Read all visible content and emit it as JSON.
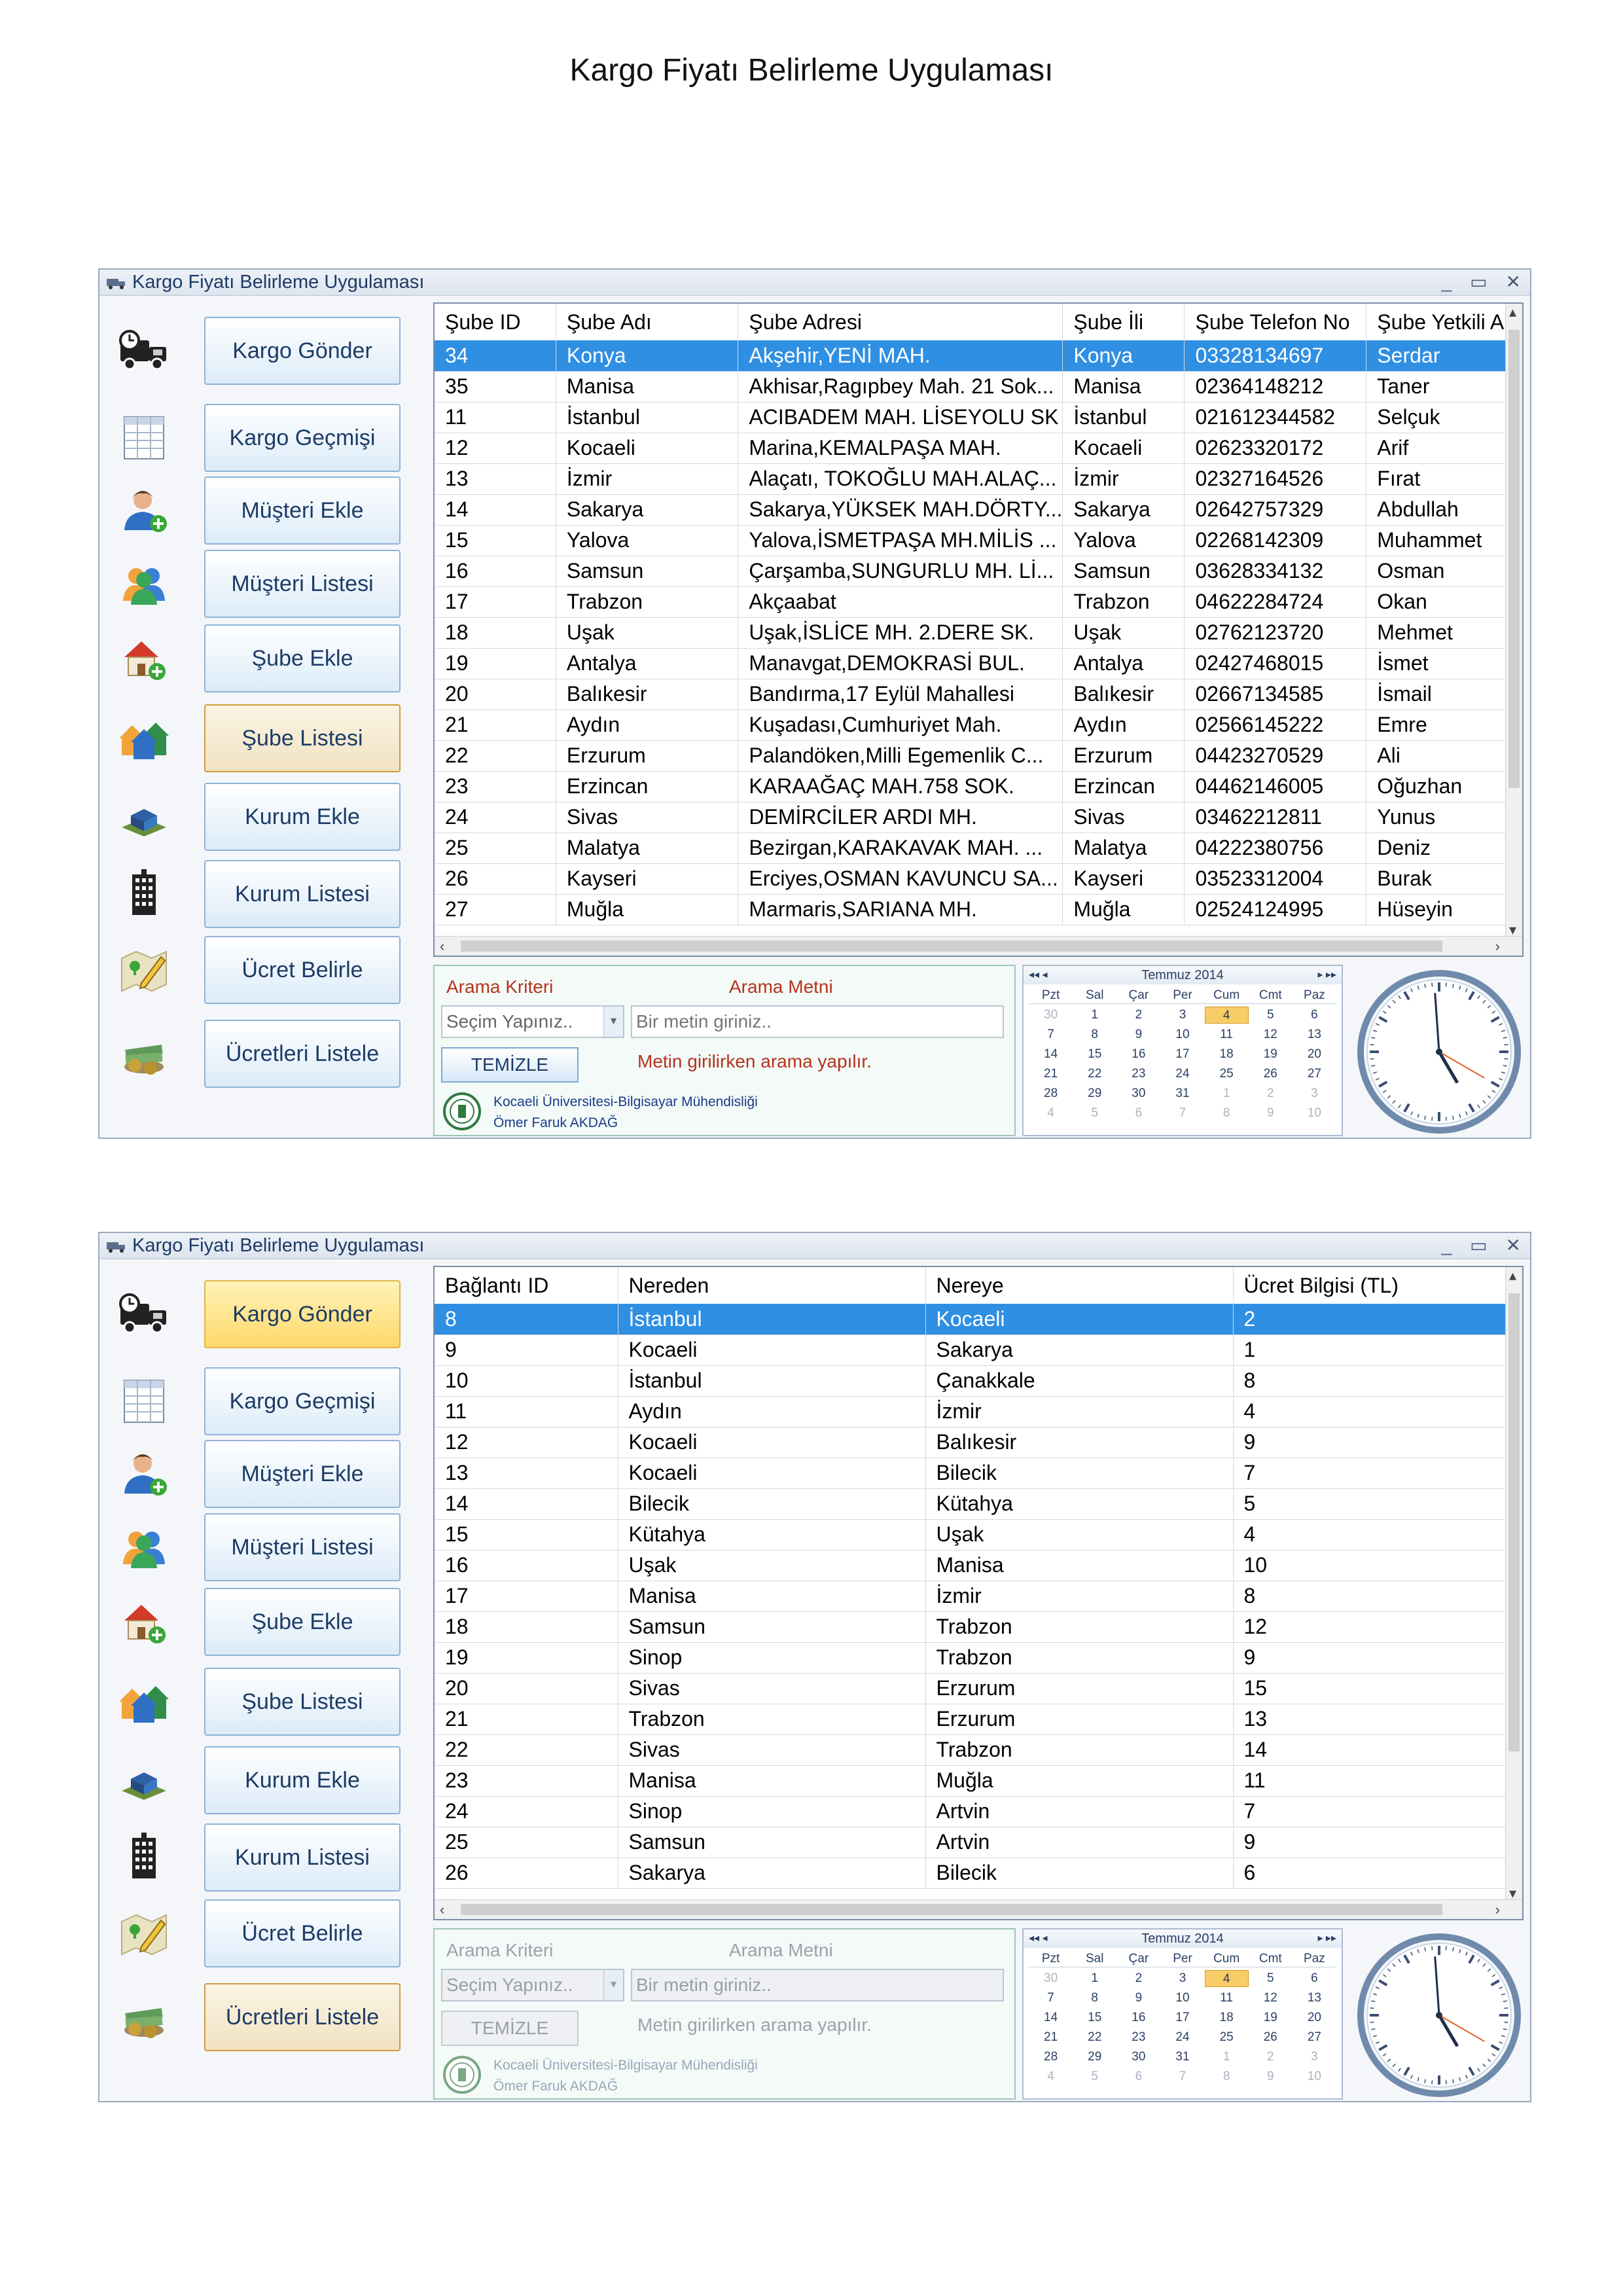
{
  "page_title": "Kargo Fiyatı Belirleme Uygulaması",
  "window_title": "Kargo Fiyatı Belirleme Uygulaması",
  "window_controls": [
    "_",
    "▭",
    "✕"
  ],
  "nav": [
    {
      "label": "Kargo Gönder",
      "icon": "truck-icon"
    },
    {
      "label": "Kargo Geçmişi",
      "icon": "table-icon"
    },
    {
      "label": "Müşteri Ekle",
      "icon": "add-user-icon"
    },
    {
      "label": "Müşteri Listesi",
      "icon": "users-icon"
    },
    {
      "label": "Şube Ekle",
      "icon": "add-house-icon"
    },
    {
      "label": "Şube Listesi",
      "icon": "houses-icon"
    },
    {
      "label": "Kurum Ekle",
      "icon": "building-add-icon"
    },
    {
      "label": "Kurum Listesi",
      "icon": "skyscraper-icon"
    },
    {
      "label": "Ücret Belirle",
      "icon": "map-pen-icon"
    },
    {
      "label": "Ücretleri Listele",
      "icon": "money-icon"
    }
  ],
  "window1": {
    "active_nav": "Şube Listesi",
    "columns": [
      "Şube ID",
      "Şube Adı",
      "Şube Adresi",
      "Şube İli",
      "Şube Telefon No",
      "Şube Yetkili A"
    ],
    "rows": [
      [
        "34",
        "Konya",
        "Akşehir,YENİ MAH.",
        "Konya",
        "03328134697",
        "Serdar"
      ],
      [
        "35",
        "Manisa",
        "Akhisar,Ragıpbey Mah. 21 Sok...",
        "Manisa",
        "02364148212",
        "Taner"
      ],
      [
        "11",
        "İstanbul",
        "ACIBADEM MAH. LİSEYOLU SK",
        "İstanbul",
        "021612344582",
        "Selçuk"
      ],
      [
        "12",
        "Kocaeli",
        "Marina,KEMALPAŞA MAH.",
        "Kocaeli",
        "02623320172",
        "Arif"
      ],
      [
        "13",
        "İzmir",
        "Alaçatı, TOKOĞLU MAH.ALAÇ...",
        "İzmir",
        "02327164526",
        "Fırat"
      ],
      [
        "14",
        "Sakarya",
        "Sakarya,YÜKSEK MAH.DÖRTY...",
        "Sakarya",
        "02642757329",
        "Abdullah"
      ],
      [
        "15",
        "Yalova",
        "Yalova,İSMETPAŞA MH.MİLİS ...",
        "Yalova",
        "02268142309",
        "Muhammet"
      ],
      [
        "16",
        "Samsun",
        "Çarşamba,SUNGURLU MH. Lİ...",
        "Samsun",
        "03628334132",
        "Osman"
      ],
      [
        "17",
        "Trabzon",
        "Akçaabat",
        "Trabzon",
        "04622284724",
        "Okan"
      ],
      [
        "18",
        "Uşak",
        "Uşak,İSLİCE MH. 2.DERE SK.",
        "Uşak",
        "02762123720",
        "Mehmet"
      ],
      [
        "19",
        "Antalya",
        "Manavgat,DEMOKRASİ BUL.",
        "Antalya",
        "02427468015",
        "İsmet"
      ],
      [
        "20",
        "Balıkesir",
        "Bandırma,17 Eylül Mahallesi",
        "Balıkesir",
        "02667134585",
        "İsmail"
      ],
      [
        "21",
        "Aydın",
        "Kuşadası,Cumhuriyet Mah.",
        "Aydın",
        "02566145222",
        "Emre"
      ],
      [
        "22",
        "Erzurum",
        "Palandöken,Milli Egemenlik C...",
        "Erzurum",
        "04423270529",
        "Ali"
      ],
      [
        "23",
        "Erzincan",
        "KARAAĞAÇ MAH.758 SOK.",
        "Erzincan",
        "04462146005",
        "Oğuzhan"
      ],
      [
        "24",
        "Sivas",
        "DEMİRCİLER ARDI MH.",
        "Sivas",
        "03462212811",
        "Yunus"
      ],
      [
        "25",
        "Malatya",
        "Bezirgan,KARAKAVAK MAH. ...",
        "Malatya",
        "04222380756",
        "Deniz"
      ],
      [
        "26",
        "Kayseri",
        "Erciyes,OSMAN KAVUNCU SA...",
        "Kayseri",
        "03523312004",
        "Burak"
      ],
      [
        "27",
        "Muğla",
        "Marmaris,SARIANA MH.",
        "Muğla",
        "02524124995",
        "Hüseyin"
      ]
    ]
  },
  "window2": {
    "active_nav": "Ücretleri Listele",
    "columns": [
      "Bağlantı ID",
      "Nereden",
      "Nereye",
      "Ücret Bilgisi (TL)"
    ],
    "rows": [
      [
        "8",
        "İstanbul",
        "Kocaeli",
        "2"
      ],
      [
        "9",
        "Kocaeli",
        "Sakarya",
        "1"
      ],
      [
        "10",
        "İstanbul",
        "Çanakkale",
        "8"
      ],
      [
        "11",
        "Aydın",
        "İzmir",
        "4"
      ],
      [
        "12",
        "Kocaeli",
        "Balıkesir",
        "9"
      ],
      [
        "13",
        "Kocaeli",
        "Bilecik",
        "7"
      ],
      [
        "14",
        "Bilecik",
        "Kütahya",
        "5"
      ],
      [
        "15",
        "Kütahya",
        "Uşak",
        "4"
      ],
      [
        "16",
        "Uşak",
        "Manisa",
        "10"
      ],
      [
        "17",
        "Manisa",
        "İzmir",
        "8"
      ],
      [
        "18",
        "Samsun",
        "Trabzon",
        "12"
      ],
      [
        "19",
        "Sinop",
        "Trabzon",
        "9"
      ],
      [
        "20",
        "Sivas",
        "Erzurum",
        "15"
      ],
      [
        "21",
        "Trabzon",
        "Erzurum",
        "13"
      ],
      [
        "22",
        "Sivas",
        "Trabzon",
        "14"
      ],
      [
        "23",
        "Manisa",
        "Muğla",
        "11"
      ],
      [
        "24",
        "Sinop",
        "Artvin",
        "7"
      ],
      [
        "25",
        "Samsun",
        "Artvin",
        "9"
      ],
      [
        "26",
        "Sakarya",
        "Bilecik",
        "6"
      ]
    ]
  },
  "search": {
    "criteria_label": "Arama Kriteri",
    "text_label": "Arama Metni",
    "select_value": "Seçim Yapınız..",
    "text_placeholder": "Bir metin giriniz..",
    "clear_button": "TEMİZLE",
    "hint": "Metin girilirken arama yapılır.",
    "institution": "Kocaeli Üniversitesi-Bilgisayar Mühendisliği",
    "author": "Ömer Faruk AKDAĞ"
  },
  "calendar": {
    "month_label": "Temmuz 2014",
    "nav_prev": "◂◂ ◂",
    "nav_next": "▸ ▸▸",
    "day_headers": [
      "Pzt",
      "Sal",
      "Çar",
      "Per",
      "Cum",
      "Cmt",
      "Paz"
    ],
    "today": "4",
    "weeks": [
      [
        "30",
        "1",
        "2",
        "3",
        "4",
        "5",
        "6"
      ],
      [
        "7",
        "8",
        "9",
        "10",
        "11",
        "12",
        "13"
      ],
      [
        "14",
        "15",
        "16",
        "17",
        "18",
        "19",
        "20"
      ],
      [
        "21",
        "22",
        "23",
        "24",
        "25",
        "26",
        "27"
      ],
      [
        "28",
        "29",
        "30",
        "31",
        "1",
        "2",
        "3"
      ],
      [
        "4",
        "5",
        "6",
        "7",
        "8",
        "9",
        "10"
      ]
    ]
  },
  "clock": {
    "hour": 4,
    "minute": 59,
    "second": 20
  },
  "colors": {
    "selection": "#2f8fe3",
    "accent_red": "#b5331f",
    "nav_border": "#8fb2d6",
    "today": "#f8cc66"
  }
}
